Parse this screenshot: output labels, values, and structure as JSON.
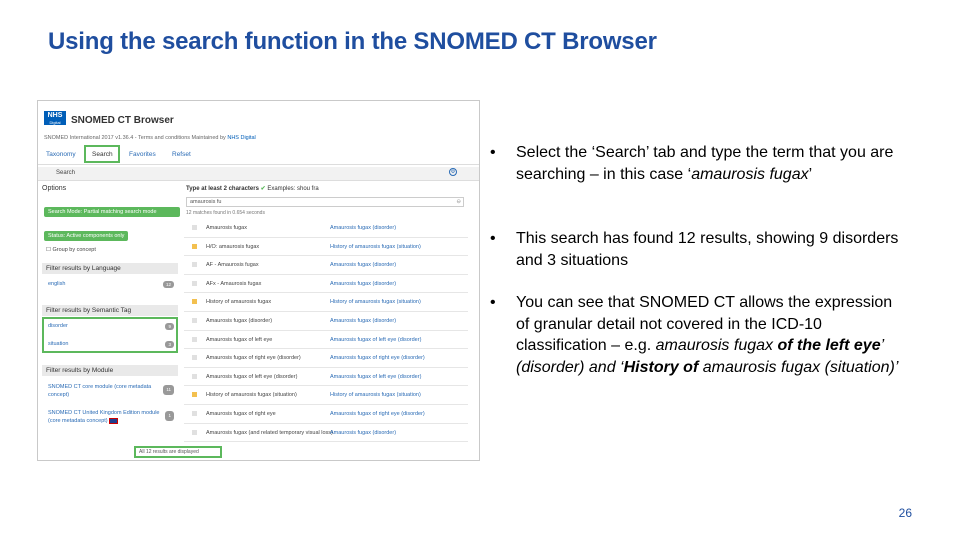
{
  "slide": {
    "title": "Using the search function in the SNOMED CT Browser",
    "page_number": "26"
  },
  "screenshot": {
    "logo": {
      "line1": "NHS",
      "line2": "Digital"
    },
    "app_title": "SNOMED CT Browser",
    "version_line": "SNOMED International 2017 v1.36.4 - Terms and conditions Maintained by",
    "version_org": "NHS Digital",
    "tabs": [
      "Taxonomy",
      "Search",
      "Favorites",
      "Refset"
    ],
    "subbar_label": "Search",
    "options": {
      "title": "Options",
      "search_mode": "Search Mode: Partial matching search mode",
      "status": "Status: Active components only",
      "group_by_concept": "Group by concept"
    },
    "filter_language": {
      "heading": "Filter results by Language",
      "items": [
        {
          "label": "english",
          "count": "12"
        }
      ]
    },
    "filter_semantic": {
      "heading": "Filter results by Semantic Tag",
      "items": [
        {
          "label": "disorder",
          "count": "9"
        },
        {
          "label": "situation",
          "count": "3"
        }
      ]
    },
    "filter_module": {
      "heading": "Filter results by Module",
      "items": [
        {
          "label": "SNOMED CT core module (core metadata concept)",
          "count": "11"
        },
        {
          "label": "SNOMED CT United Kingdom Edition module (core metadata concept)",
          "count": "1"
        }
      ]
    },
    "search": {
      "type_hint": "Type at least 2 characters",
      "examples": "Examples: shou fra",
      "query": "amaurosis fu",
      "found_text": "12 matches found in 0.654 seconds"
    },
    "results": [
      {
        "term": "Amaurosis fugax",
        "concept": "Amaurosis fugax (disorder)",
        "kind": "disorder"
      },
      {
        "term": "H/O: amaurosis fugax",
        "concept": "History of amaurosis fugax (situation)",
        "kind": "situation"
      },
      {
        "term": "AF - Amaurosis fugax",
        "concept": "Amaurosis fugax (disorder)",
        "kind": "disorder"
      },
      {
        "term": "AFx - Amaurosis fugax",
        "concept": "Amaurosis fugax (disorder)",
        "kind": "disorder"
      },
      {
        "term": "History of amaurosis fugax",
        "concept": "History of amaurosis fugax (situation)",
        "kind": "situation"
      },
      {
        "term": "Amaurosis fugax (disorder)",
        "concept": "Amaurosis fugax (disorder)",
        "kind": "disorder"
      },
      {
        "term": "Amaurosis fugax of left eye",
        "concept": "Amaurosis fugax of left eye (disorder)",
        "kind": "disorder"
      },
      {
        "term": "Amaurosis fugax of right eye (disorder)",
        "concept": "Amaurosis fugax of right eye (disorder)",
        "kind": "disorder"
      },
      {
        "term": "Amaurosis fugax of left eye (disorder)",
        "concept": "Amaurosis fugax of left eye (disorder)",
        "kind": "disorder"
      },
      {
        "term": "History of amaurosis fugax (situation)",
        "concept": "History of amaurosis fugax (situation)",
        "kind": "situation"
      },
      {
        "term": "Amaurosis fugax of right eye",
        "concept": "Amaurosis fugax of right eye (disorder)",
        "kind": "disorder"
      },
      {
        "term": "Amaurosis fugax (and related temporary visual loss)",
        "concept": "Amaurosis fugax (disorder)",
        "kind": "disorder"
      }
    ],
    "all_shown": "All 12 results are displayed",
    "highlight_color": "#5cb85c"
  },
  "bullets": [
    {
      "parts": [
        {
          "t": "Select the ‘Search’ tab and type the term that you are searching – in this case ‘"
        },
        {
          "t": "amaurosis fugax",
          "i": true
        },
        {
          "t": "’"
        }
      ]
    },
    {
      "parts": [
        {
          "t": "This search has found 12 results, showing 9 disorders and 3 situations"
        }
      ]
    },
    {
      "parts": [
        {
          "t": "You can see that SNOMED CT allows the expression of granular detail not covered in the ICD-10 classification – e.g. "
        },
        {
          "t": "amaurosis fugax ",
          "i": true
        },
        {
          "t": "of the left eye",
          "i": true,
          "b": true
        },
        {
          "t": "’ (disorder) and ‘",
          "i": true
        },
        {
          "t": "History of",
          "i": true,
          "b": true
        },
        {
          "t": " amaurosis fugax (situation)’",
          "i": true
        }
      ]
    }
  ],
  "colors": {
    "title": "#1f4e9f",
    "accent_green": "#5cb85c",
    "nhs_blue": "#005eb8"
  }
}
